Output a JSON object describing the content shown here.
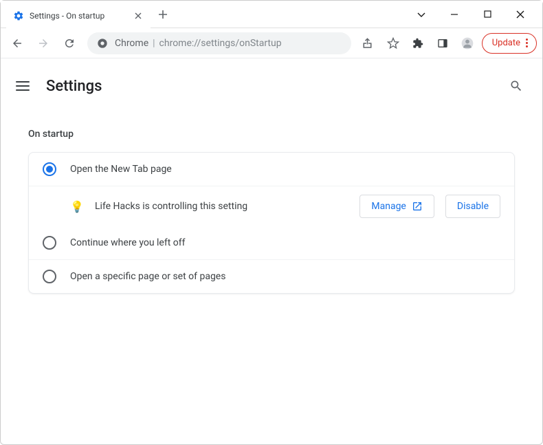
{
  "window": {
    "tab_title": "Settings - On startup"
  },
  "addressbar": {
    "host": "Chrome",
    "url_display": "chrome://settings/onStartup",
    "update_label": "Update"
  },
  "page": {
    "title": "Settings",
    "section_title": "On startup"
  },
  "startup": {
    "option_newtab": "Open the New Tab page",
    "option_continue": "Continue where you left off",
    "option_specific": "Open a specific page or set of pages",
    "extension_notice": "Life Hacks is controlling this setting",
    "manage_label": "Manage",
    "disable_label": "Disable"
  }
}
